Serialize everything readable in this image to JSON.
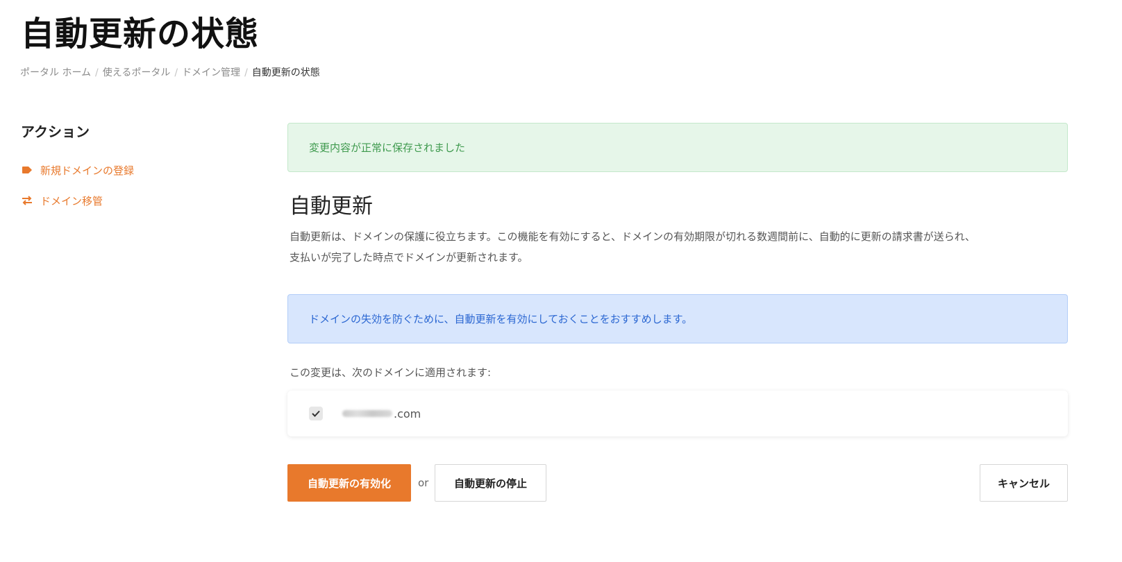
{
  "page": {
    "title": "自動更新の状態"
  },
  "breadcrumb": {
    "items": [
      "ポータル ホーム",
      "使えるポータル",
      "ドメイン管理"
    ],
    "current": "自動更新の状態",
    "separator": "/"
  },
  "sidebar": {
    "title": "アクション",
    "items": [
      {
        "label": "新規ドメインの登録",
        "icon": "tag-icon"
      },
      {
        "label": "ドメイン移管",
        "icon": "exchange-icon"
      }
    ]
  },
  "main": {
    "success_message": "変更内容が正常に保存されました",
    "section_title": "自動更新",
    "description_line1": "自動更新は、ドメインの保護に役立ちます。この機能を有効にすると、ドメインの有効期限が切れる数週間前に、自動的に更新の請求書が送られ、",
    "description_line2": "支払いが完了した時点でドメインが更新されます。",
    "info_message": "ドメインの失効を防ぐために、自動更新を有効にしておくことをおすすめします。",
    "apply_label": "この変更は、次のドメインに適用されます:",
    "domains": [
      {
        "name_suffix": ".com",
        "checked": true
      }
    ]
  },
  "actions": {
    "enable_label": "自動更新の有効化",
    "or_text": "or",
    "disable_label": "自動更新の停止",
    "cancel_label": "キャンセル"
  },
  "colors": {
    "accent": "#e8792c",
    "success_bg": "#e6f6e9",
    "success_text": "#3f9a4e",
    "info_bg": "#d8e6fd",
    "info_text": "#2b67d2"
  }
}
